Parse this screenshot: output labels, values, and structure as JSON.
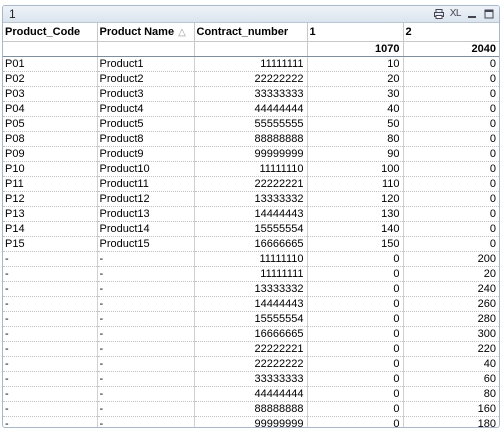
{
  "window": {
    "title": "1",
    "xl_label": "XL"
  },
  "columns": [
    "Product_Code",
    "Product Name",
    "Contract_number",
    "1",
    "2"
  ],
  "totals": {
    "col1": "1070",
    "col2": "2040"
  },
  "rows": [
    [
      "P01",
      "Product1",
      "11111111",
      "10",
      "0"
    ],
    [
      "P02",
      "Product2",
      "22222222",
      "20",
      "0"
    ],
    [
      "P03",
      "Product3",
      "33333333",
      "30",
      "0"
    ],
    [
      "P04",
      "Product4",
      "44444444",
      "40",
      "0"
    ],
    [
      "P05",
      "Product5",
      "55555555",
      "50",
      "0"
    ],
    [
      "P08",
      "Product8",
      "88888888",
      "80",
      "0"
    ],
    [
      "P09",
      "Product9",
      "99999999",
      "90",
      "0"
    ],
    [
      "P10",
      "Product10",
      "11111110",
      "100",
      "0"
    ],
    [
      "P11",
      "Product11",
      "22222221",
      "110",
      "0"
    ],
    [
      "P12",
      "Product12",
      "13333332",
      "120",
      "0"
    ],
    [
      "P13",
      "Product13",
      "14444443",
      "130",
      "0"
    ],
    [
      "P14",
      "Product14",
      "15555554",
      "140",
      "0"
    ],
    [
      "P15",
      "Product15",
      "16666665",
      "150",
      "0"
    ],
    [
      "-",
      "-",
      "11111110",
      "0",
      "200"
    ],
    [
      "-",
      "-",
      "11111111",
      "0",
      "20"
    ],
    [
      "-",
      "-",
      "13333332",
      "0",
      "240"
    ],
    [
      "-",
      "-",
      "14444443",
      "0",
      "260"
    ],
    [
      "-",
      "-",
      "15555554",
      "0",
      "280"
    ],
    [
      "-",
      "-",
      "16666665",
      "0",
      "300"
    ],
    [
      "-",
      "-",
      "22222221",
      "0",
      "220"
    ],
    [
      "-",
      "-",
      "22222222",
      "0",
      "40"
    ],
    [
      "-",
      "-",
      "33333333",
      "0",
      "60"
    ],
    [
      "-",
      "-",
      "44444444",
      "0",
      "80"
    ],
    [
      "-",
      "-",
      "88888888",
      "0",
      "160"
    ],
    [
      "-",
      "-",
      "99999999",
      "0",
      "180"
    ]
  ]
}
